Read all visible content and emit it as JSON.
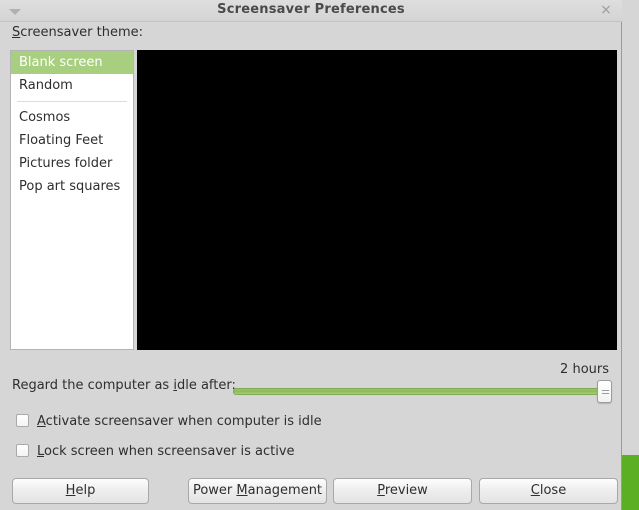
{
  "window": {
    "title": "Screensaver Preferences",
    "menu_icon": "chevron-down-icon",
    "close_icon": "×"
  },
  "theme_section": {
    "label_mnemonic": "S",
    "label_rest": "creensaver theme:",
    "items": [
      {
        "label": "Blank screen",
        "selected": true
      },
      {
        "label": "Random",
        "selected": false
      },
      {
        "label": "Cosmos",
        "selected": false
      },
      {
        "label": "Floating Feet",
        "selected": false
      },
      {
        "label": "Pictures folder",
        "selected": false
      },
      {
        "label": "Pop art squares",
        "selected": false
      }
    ],
    "separator_after_index": 1
  },
  "preview": {
    "background_color": "#000000"
  },
  "idle": {
    "value_label": "2 hours",
    "label_pre": "Regard the computer as ",
    "label_mnemonic": "i",
    "label_post": "dle after:",
    "slider_percent": 100
  },
  "checkboxes": [
    {
      "checked": false,
      "pre": "",
      "mnemonic": "A",
      "post": "ctivate screensaver when computer is idle"
    },
    {
      "checked": false,
      "pre": "",
      "mnemonic": "L",
      "post": "ock screen when screensaver is active"
    }
  ],
  "buttons": [
    {
      "pre": "",
      "mnemonic": "H",
      "post": "elp"
    },
    {
      "pre": "Power ",
      "mnemonic": "M",
      "post": "anagement"
    },
    {
      "pre": "",
      "mnemonic": "P",
      "post": "review"
    },
    {
      "pre": "",
      "mnemonic": "C",
      "post": "lose"
    }
  ],
  "colors": {
    "window_bg": "#d6d6d6",
    "selection_green": "#a8cf80",
    "desktop_green": "#5ab022",
    "slider_green": "#8cba5a"
  }
}
